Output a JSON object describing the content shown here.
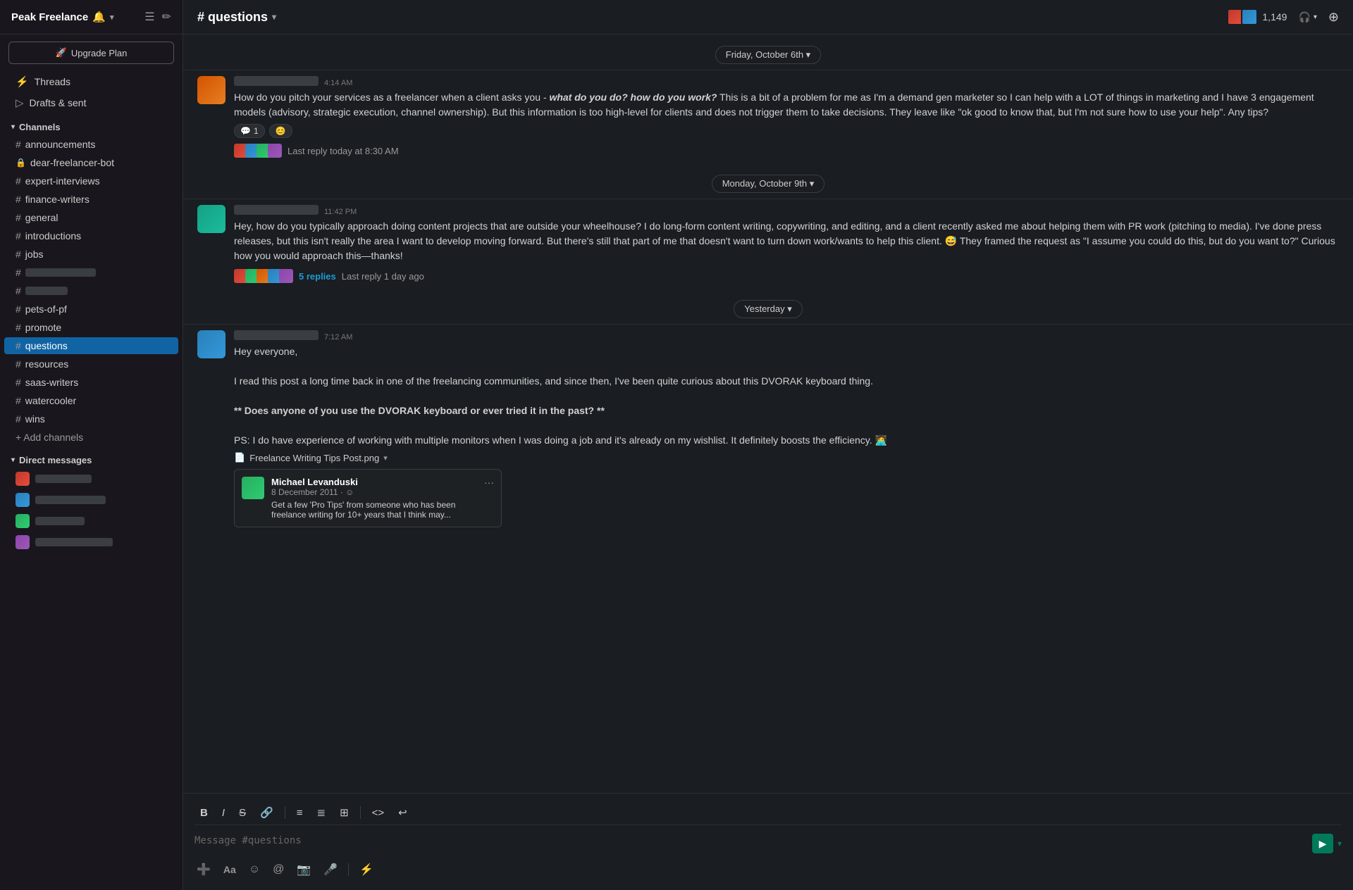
{
  "workspace": {
    "name": "Peak Freelance",
    "emoji": "🔔",
    "chevron": "▾"
  },
  "header_icons": {
    "filter": "☰",
    "compose": "✏"
  },
  "upgrade_btn": "Upgrade Plan",
  "nav": {
    "threads": "Threads",
    "drafts": "Drafts & sent"
  },
  "sections": {
    "channels": "Channels",
    "direct_messages": "Direct messages"
  },
  "channels": [
    {
      "name": "announcements",
      "type": "hash"
    },
    {
      "name": "dear-freelancer-bot",
      "type": "lock"
    },
    {
      "name": "expert-interviews",
      "type": "hash"
    },
    {
      "name": "finance-writers",
      "type": "hash"
    },
    {
      "name": "general",
      "type": "hash"
    },
    {
      "name": "introductions",
      "type": "hash"
    },
    {
      "name": "jobs",
      "type": "hash"
    },
    {
      "name": "pets-of-pf",
      "type": "hash"
    },
    {
      "name": "promote",
      "type": "hash"
    },
    {
      "name": "questions",
      "type": "hash",
      "active": true
    },
    {
      "name": "resources",
      "type": "hash"
    },
    {
      "name": "saas-writers",
      "type": "hash"
    },
    {
      "name": "watercooler",
      "type": "hash"
    },
    {
      "name": "wins",
      "type": "hash"
    }
  ],
  "add_channels": "+ Add channels",
  "channel_header": {
    "title": "# questions",
    "chevron": "▾",
    "member_count": "1,149",
    "headphone_icon": "🎧"
  },
  "date_dividers": {
    "friday": "Friday, October 6th ▾",
    "monday": "Monday, October 9th ▾",
    "yesterday": "Yesterday ▾"
  },
  "messages": [
    {
      "id": "msg1",
      "time": "4:14 AM",
      "text": "How do you pitch your services as a freelancer when a client asks you - what do you do? how do you work? This is a bit of a problem for me as I'm a demand gen marketer so I can help with a LOT of things in marketing and I have 3 engagement models (advisory, strategic execution, channel ownership). But this information is too high-level for clients and does not trigger them to take decisions. They leave like \"ok good to know that, but I'm not sure how to use your help\". Any tips?",
      "reactions": [
        {
          "emoji": "💬",
          "count": "1"
        }
      ],
      "thread_last": "Last reply today at 8:30 AM",
      "has_thread_avatars": true
    },
    {
      "id": "msg2",
      "time": "11:42 PM",
      "text": "Hey, how do you typically approach doing content projects that are outside your wheelhouse? I do long-form content writing, copywriting, and editing, and a client recently asked me about helping them with PR work (pitching to media). I've done press releases, but this isn't really the area I want to develop moving forward. But there's still that part of me that doesn't want to turn down work/wants to help this client. 😅 They framed the request as \"I assume you could do this, but do you want to?\" Curious how you would approach this—thanks!",
      "replies_count": "5 replies",
      "thread_last": "Last reply 1 day ago",
      "has_thread_avatars": true
    },
    {
      "id": "msg3",
      "time": "7:12 AM",
      "greeting": "Hey everyone,",
      "para1": "I read this post a long time back in one of the freelancing communities, and since then, I've been quite curious about this DVORAK keyboard thing.",
      "bold_question": "** Does anyone of you use the DVORAK keyboard or ever tried it in the past? **",
      "para2": "PS: I do have experience of working with multiple monitors when I was doing a job and it's already on my wishlist. It definitely boosts the efficiency. 🧑‍💻",
      "file_name": "Freelance Writing Tips Post.png",
      "has_attachment": true,
      "attachment_person": "Michael Levanduski",
      "attachment_meta": "8 December 2011 · ☺",
      "attachment_preview": "Get a few 'Pro Tips' from someone who has been freelance writing for 10+ years that I think may..."
    }
  ],
  "message_input": {
    "placeholder": "Message #questions"
  },
  "toolbar_buttons": [
    "B",
    "I",
    "S",
    "🔗",
    "≡",
    "≣",
    "⊞",
    "<>",
    "↩"
  ],
  "input_footer_buttons": [
    "➕",
    "Aa",
    "☺",
    "@",
    "📷",
    "🎤",
    "⚡"
  ]
}
